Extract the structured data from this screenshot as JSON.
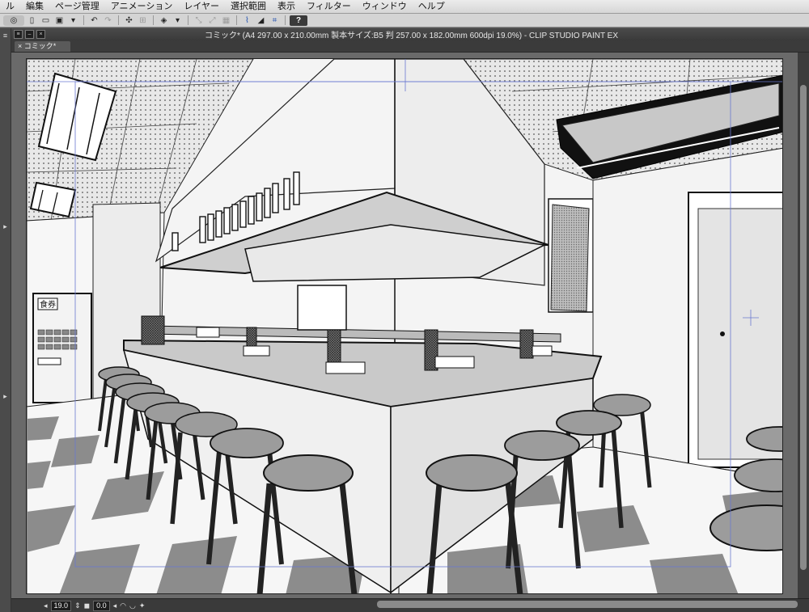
{
  "menu": {
    "items": [
      "ル",
      "編集",
      "ページ管理",
      "アニメーション",
      "レイヤー",
      "選択範囲",
      "表示",
      "フィルター",
      "ウィンドウ",
      "ヘルプ"
    ]
  },
  "toolbar": {
    "help_label": "?"
  },
  "window": {
    "title": "コミック* (A4 297.00 x 210.00mm 製本サイズ:B5 判 257.00 x 182.00mm 600dpi 19.0%)  - CLIP STUDIO PAINT EX",
    "tab_label": "コミック*"
  },
  "illustration": {
    "ticket_machine_label": "食券"
  },
  "status": {
    "zoom": "19.0",
    "angle": "0.0"
  }
}
